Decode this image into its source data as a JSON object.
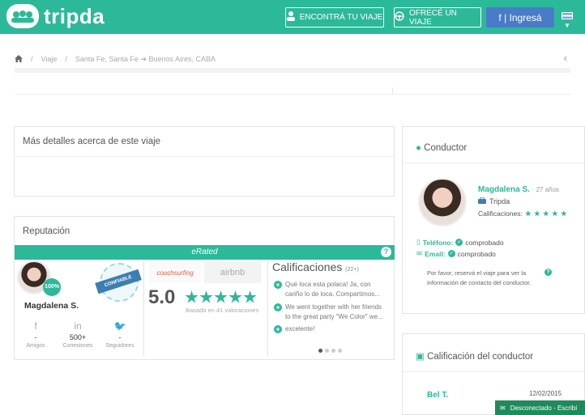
{
  "header": {
    "brand": "tripda",
    "find_trip": "ENCONTRÁ TU VIAJE",
    "offer_trip": "OFRECÉ UN VIAJE",
    "login": "f | Ingresá"
  },
  "breadcrumb": {
    "items": [
      "Viaje",
      "Santa Fe, Santa Fe ➔ Buenos Aires, CABA"
    ],
    "separator": "/"
  },
  "details": {
    "title": "Más detalles acerca de este viaje"
  },
  "reputation": {
    "title": "Reputación",
    "brand": "eRated",
    "help": "?",
    "badge_percent": "100%",
    "seal_label": "CONFIABLE",
    "name": "Magdalena S.",
    "stats": [
      {
        "icon": "f",
        "value": "-",
        "label": "Amigos"
      },
      {
        "icon": "in",
        "value": "500+",
        "label": "Conexiones"
      },
      {
        "icon": "🐦",
        "value": "-",
        "label": "Seguidores"
      }
    ],
    "partners": [
      "couchsurfing",
      "airbnb"
    ],
    "score": "5.0",
    "based_on": "Basada en 41 valoraciones",
    "ratings_title": "Calificaciones",
    "ratings_count": "(22+)",
    "reviews": [
      "Qué loca esta polaca! Ja, con cariño lo de loca. Compartimos...",
      "We went together with her friends to the great party \"We Color\" we...",
      "excelente!"
    ]
  },
  "driver": {
    "title": "Conductor",
    "name": "Magdalena S.",
    "age": "· 27 años",
    "company": "Tripda",
    "ratings_label": "Calificaciones:",
    "phone_label": "Teléfono:",
    "phone_status": "comprobado",
    "email_label": "Email:",
    "email_status": "comprobado",
    "note": "Por favor, reservá el viaje para ver la información de contacto del conductor."
  },
  "driver_rating": {
    "title": "Calificación del conductor",
    "reviewer": "Bel T.",
    "date": "12/02/2015"
  },
  "chat": {
    "status": "Desconectado - Escribí"
  },
  "colors": {
    "primary": "#2bb999",
    "facebook": "#4a7bc8"
  }
}
